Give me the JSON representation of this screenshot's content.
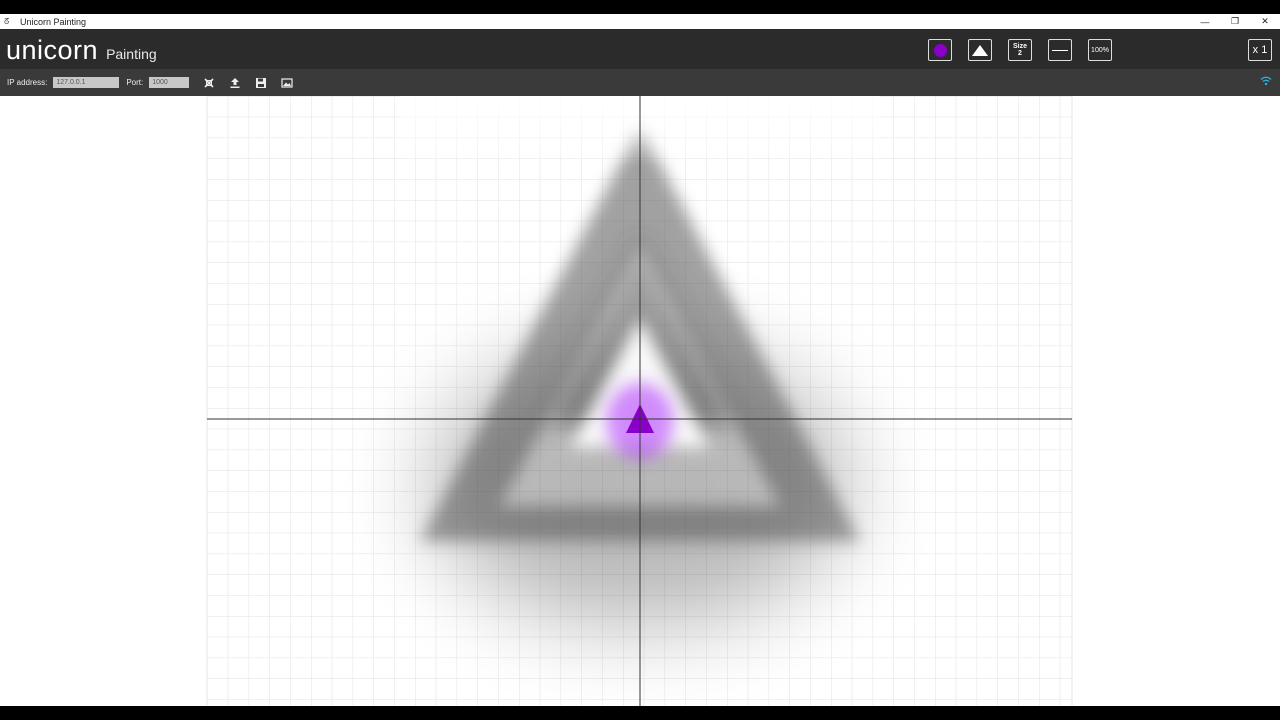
{
  "window": {
    "title": "Unicorn Painting",
    "app_icon": "unicorn-app-icon",
    "controls": {
      "minimize": "—",
      "restore": "❐",
      "close": "✕"
    }
  },
  "header": {
    "brand": "unicorn",
    "subtitle": "Painting",
    "tools": {
      "color_icon": "purple-dot-icon",
      "color_value": "#8a00c8",
      "shape_icon": "triangle-icon",
      "size_label": "Size",
      "size_value": "2",
      "line_icon": "line-icon",
      "zoom_label": "100%",
      "count_label": "x 1"
    }
  },
  "toolbar": {
    "ip_label": "IP address:",
    "ip_value": "127.0.0.1",
    "port_label": "Port:",
    "port_value": "1000",
    "icons": [
      "disconnect-icon",
      "upload-icon",
      "save-icon",
      "image-icon"
    ],
    "status_icon": "wifi-icon",
    "status_color": "#29b6e8"
  },
  "canvas": {
    "grid_color": "#e2e2e2",
    "axis_color": "#333333",
    "shape_color": "#8a00c8"
  }
}
